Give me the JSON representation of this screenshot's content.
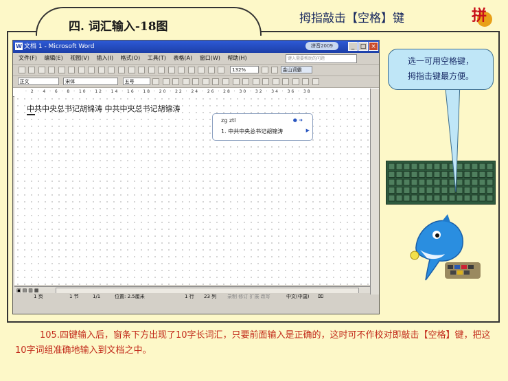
{
  "header": {
    "lesson_title": "四. 词汇输入-18图",
    "subtitle": "拇指敲击【空格】键",
    "logo_glyph": "拼"
  },
  "word_window": {
    "title": "文档 1 - Microsoft Word",
    "search_badge": "拼音2009",
    "menu": [
      "文件(F)",
      "编辑(E)",
      "视图(V)",
      "插入(I)",
      "格式(O)",
      "工具(T)",
      "表格(A)",
      "窗口(W)",
      "帮助(H)"
    ],
    "help_placeholder": "键入需要帮助的问题",
    "zoom": "132%",
    "style_combo": "正文",
    "font_combo": "宋体",
    "size_combo": "五号",
    "ime_button": "金山词霸",
    "doc_text": "中共中央总书记胡锦涛  中共中央总书记胡锦涛",
    "ime": {
      "code": "zg ztl",
      "candidate": "1. 中共中央总书记胡锦涛"
    },
    "status": {
      "page": "1 页",
      "section": "1 节",
      "page_of": "1/1",
      "position": "位置: 2.5厘米",
      "line": "1 行",
      "col": "23 列",
      "flags": "录制  修订  扩展  改写",
      "lang": "中文(中国)"
    }
  },
  "callout": {
    "line1": "选一可用空格键，",
    "line2": "拇指击键最方便。"
  },
  "bottom_note": "105.四键输入后，窗条下方出现了10字长词汇，只要前面输入是正确的，这时可不作校对即敲击【空格】键，把这10字词组准确地输入到文档之中。",
  "colors": {
    "background": "#fdf8c8",
    "accent_text": "#c22a1a",
    "title_bar": "#1d3fa8",
    "callout": "#bfe6f7",
    "keyboard": "#2e5a3e"
  }
}
